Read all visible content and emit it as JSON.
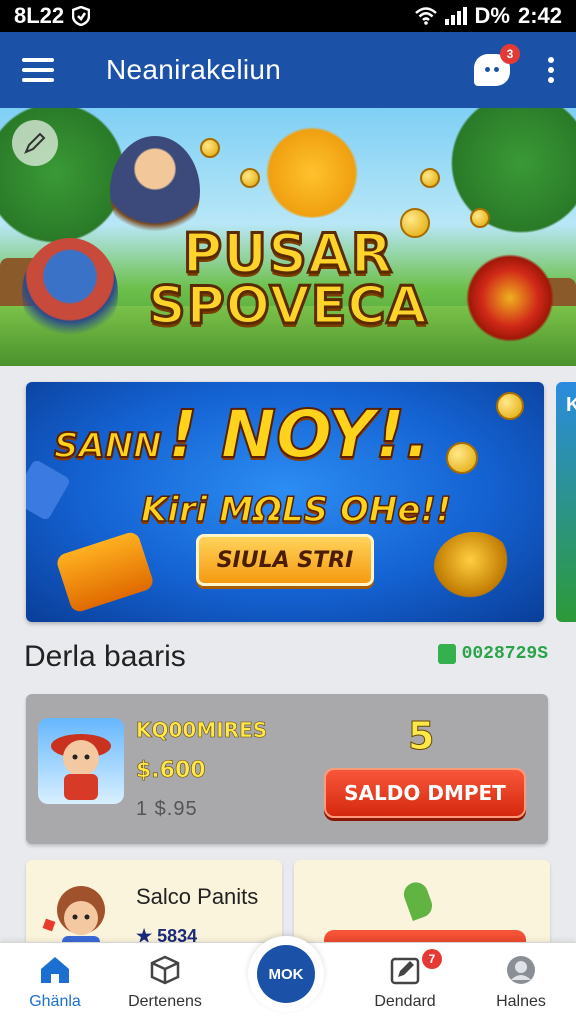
{
  "status_bar": {
    "left_text": "8L22",
    "time": "2:42",
    "battery_text": "D%"
  },
  "app_bar": {
    "title": "Neanirakeliun",
    "chat_badge": "3"
  },
  "hero": {
    "title_line1": "PUSAR",
    "title_line2": "SPOVECA"
  },
  "promo": {
    "headline_small": "SANN",
    "headline_big": "! NOY!.",
    "subline": "Kiri MΩLS OHe!!",
    "button_label": "SIULA STRI",
    "peek_letter": "K"
  },
  "section": {
    "title": "Derla baaris",
    "balance": "0028729S"
  },
  "cards": [
    {
      "name": "KQ00MIRES",
      "price": "$.600",
      "sub": "1 $.95",
      "number": "5",
      "button_label": "SALDO DMPET"
    },
    {
      "name": "Salco Panits",
      "price": "★ 5834"
    }
  ],
  "bottom_nav": {
    "items": [
      {
        "label": "Ghänla",
        "icon": "home-icon"
      },
      {
        "label": "Dertenens",
        "icon": "cube-icon"
      },
      {
        "label": "Dendard",
        "icon": "edit-box-icon",
        "badge": "7"
      },
      {
        "label": "Halnes",
        "icon": "profile-icon"
      }
    ],
    "center_label": "MOK"
  },
  "colors": {
    "app_bar": "#1b52a8",
    "accent_red": "#e53935",
    "gold": "#ffd42a",
    "green": "#2aa44a"
  }
}
